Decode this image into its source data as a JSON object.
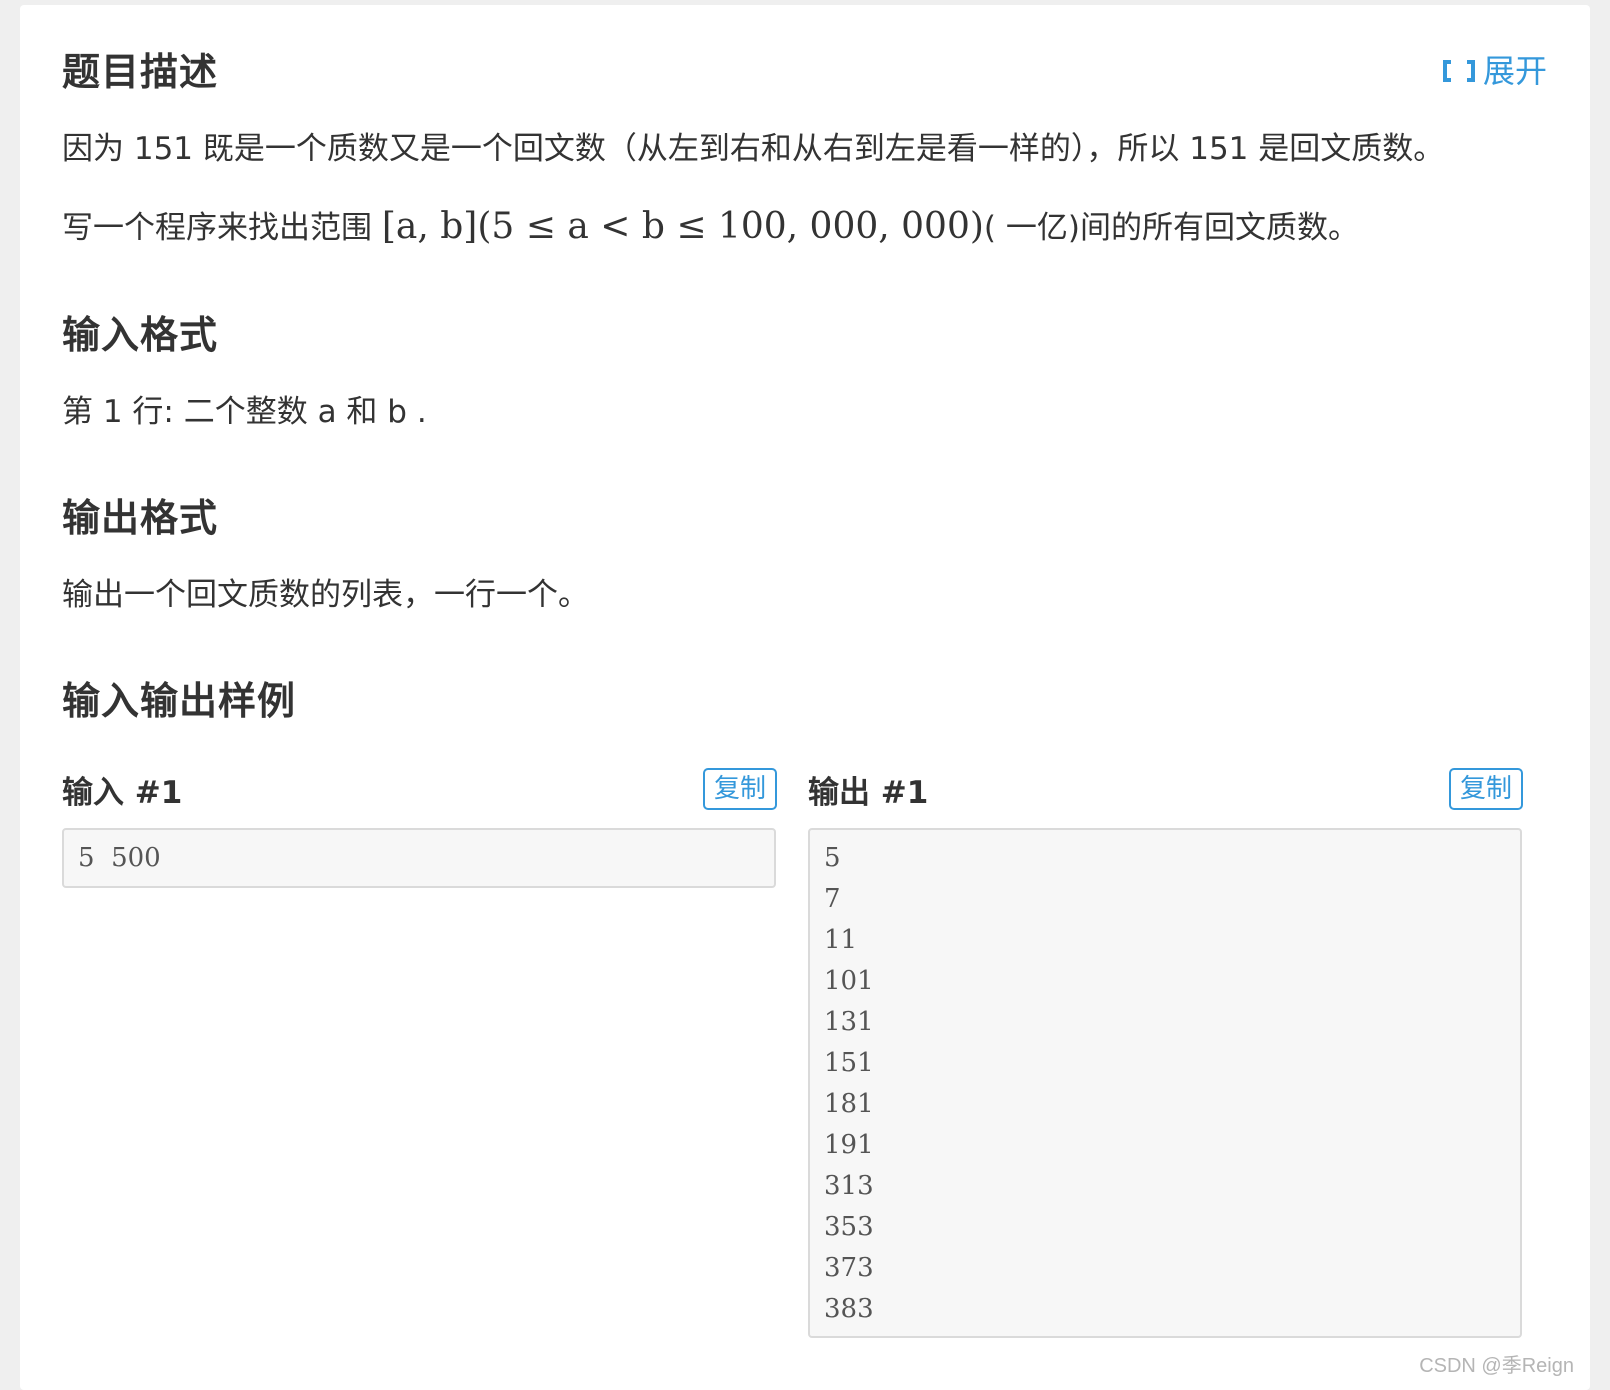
{
  "header": {
    "title": "题目描述",
    "expand_label": "展开",
    "expand_icon": "expand-icon"
  },
  "description": {
    "line1": "因为 151 既是一个质数又是一个回文数（从左到右和从右到左是看一样的），所以 151 是回文质数。",
    "line2_prefix": "写一个程序来找出范围 ",
    "line2_math": "[a, b](5 ≤ a < b ≤ 100, 000, 000)",
    "line2_suffix": "( 一亿)间的所有回文质数。"
  },
  "input_format": {
    "title": "输入格式",
    "text": "第 1 行: 二个整数 a 和 b ."
  },
  "output_format": {
    "title": "输出格式",
    "text": "输出一个回文质数的列表，一行一个。"
  },
  "samples": {
    "title": "输入输出样例",
    "input_label": "输入 #1",
    "output_label": "输出 #1",
    "copy_label": "复制",
    "input_value": "5  500",
    "output_lines": [
      "5",
      "7",
      "11",
      "101",
      "131",
      "151",
      "181",
      "191",
      "313",
      "353",
      "373",
      "383"
    ]
  },
  "watermark": "CSDN @季Reign"
}
